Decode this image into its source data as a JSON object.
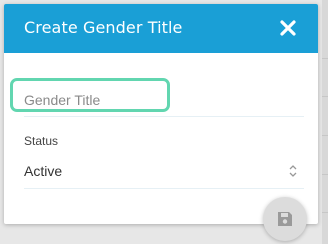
{
  "dialog": {
    "title": "Create Gender Title",
    "close_icon": "close-icon",
    "header_color": "#1a9fd6"
  },
  "form": {
    "gender_title": {
      "placeholder": "Gender Title",
      "value": ""
    },
    "status": {
      "label": "Status",
      "selected": "Active"
    }
  },
  "actions": {
    "save_icon": "floppy-disk-icon"
  },
  "colors": {
    "focus_ring": "#62d6b0",
    "fab_bg": "#dcdcdc"
  }
}
